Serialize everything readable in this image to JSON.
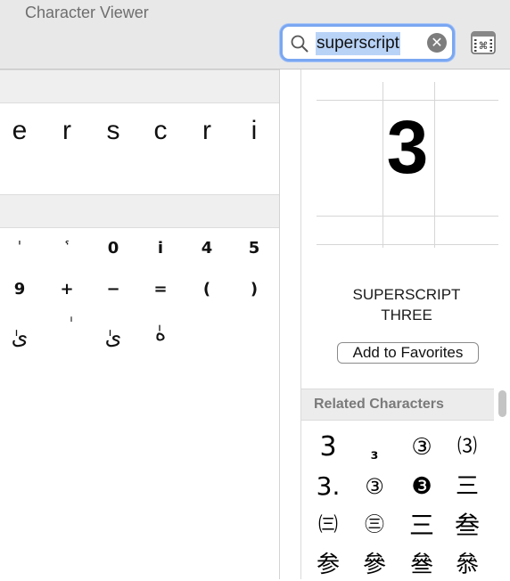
{
  "window": {
    "title": "Character Viewer"
  },
  "search": {
    "query": "superscript"
  },
  "results": {
    "letters": [
      "e",
      "r",
      "s",
      "c",
      "r",
      "i"
    ],
    "grid": [
      [
        "ˡ",
        "ˤ",
        "0",
        "i",
        "4",
        "5"
      ],
      [
        "9",
        "+",
        "−",
        "=",
        "(",
        ")"
      ],
      [
        "ىٰ",
        "ٰ",
        "ىٰ",
        "هٰ"
      ]
    ]
  },
  "preview": {
    "character": "3",
    "name_line1": "SUPERSCRIPT",
    "name_line2": "THREE",
    "favorites_button": "Add to Favorites"
  },
  "related": {
    "title": "Related Characters",
    "items": [
      [
        "3",
        "₃",
        "③",
        "⑶"
      ],
      [
        "3.",
        "③",
        "❸",
        "三"
      ],
      [
        "㈢",
        "㊂",
        "三",
        "叁"
      ],
      [
        "参",
        "參",
        "叄",
        "叅"
      ]
    ]
  }
}
